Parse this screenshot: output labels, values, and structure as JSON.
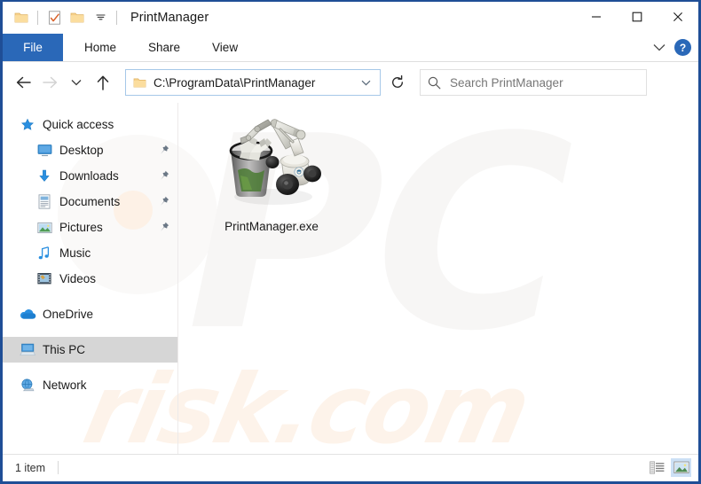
{
  "window": {
    "title": "PrintManager",
    "quick_access_icons": [
      "folder-icon",
      "properties-icon",
      "new-folder-icon",
      "customize-qat-chevron-icon"
    ],
    "controls": {
      "minimize": "minimize-icon",
      "maximize": "maximize-icon",
      "close": "close-icon"
    },
    "frame_color": "#1f4e96"
  },
  "ribbon": {
    "tabs": [
      {
        "label": "File",
        "active": true
      },
      {
        "label": "Home",
        "active": false
      },
      {
        "label": "Share",
        "active": false
      },
      {
        "label": "View",
        "active": false
      }
    ],
    "collapse_icon": "chevron-down-icon",
    "help_label": "?",
    "file_tab_color": "#2a68b8"
  },
  "addressbar": {
    "back_icon": "back-arrow-icon",
    "forward_icon": "forward-arrow-icon",
    "recent_icon": "recent-locations-chevron-icon",
    "up_icon": "up-arrow-icon",
    "path": "C:\\ProgramData\\PrintManager",
    "path_icon": "folder-icon",
    "dropdown_icon": "chevron-down-icon",
    "refresh_icon": "refresh-icon"
  },
  "search": {
    "icon": "search-icon",
    "placeholder": "Search PrintManager"
  },
  "sidebar": {
    "items": [
      {
        "label": "Quick access",
        "icon": "star-icon",
        "level": 0,
        "pinned": false,
        "selected": false
      },
      {
        "label": "Desktop",
        "icon": "desktop-icon",
        "level": 1,
        "pinned": true,
        "selected": false
      },
      {
        "label": "Downloads",
        "icon": "downloads-icon",
        "level": 1,
        "pinned": true,
        "selected": false
      },
      {
        "label": "Documents",
        "icon": "documents-icon",
        "level": 1,
        "pinned": true,
        "selected": false
      },
      {
        "label": "Pictures",
        "icon": "pictures-icon",
        "level": 1,
        "pinned": true,
        "selected": false
      },
      {
        "label": "Music",
        "icon": "music-icon",
        "level": 1,
        "pinned": false,
        "selected": false
      },
      {
        "label": "Videos",
        "icon": "videos-icon",
        "level": 1,
        "pinned": false,
        "selected": false
      },
      {
        "label": "OneDrive",
        "icon": "onedrive-icon",
        "level": 0,
        "pinned": false,
        "selected": false
      },
      {
        "label": "This PC",
        "icon": "this-pc-icon",
        "level": 0,
        "pinned": false,
        "selected": true
      },
      {
        "label": "Network",
        "icon": "network-icon",
        "level": 0,
        "pinned": false,
        "selected": false
      }
    ]
  },
  "content": {
    "files": [
      {
        "name": "PrintManager.exe",
        "icon": "robot-arm-trash-bin-icon"
      }
    ]
  },
  "statusbar": {
    "item_count": "1 item",
    "views": [
      {
        "name": "details-view",
        "icon": "details-view-icon",
        "active": false
      },
      {
        "name": "large-icons-view",
        "icon": "large-icons-view-icon",
        "active": true
      }
    ]
  },
  "watermark": {
    "big": "PC",
    "small": "risk.com"
  }
}
